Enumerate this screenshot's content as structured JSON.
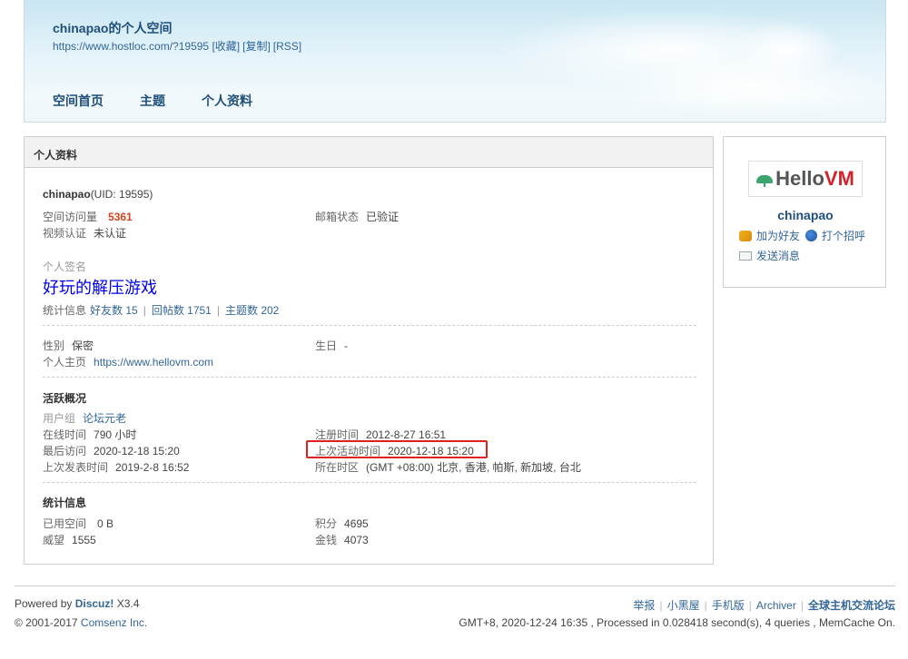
{
  "header": {
    "title": "chinapao的个人空间",
    "url": "https://www.hostloc.com/?19595",
    "link_collect": "[收藏]",
    "link_copy": "[复制]",
    "link_rss": "[RSS]",
    "nav": [
      "空间首页",
      "主题",
      "个人资料"
    ]
  },
  "profile": {
    "panel_title": "个人资料",
    "username": "chinapao",
    "uid": "(UID: 19595)",
    "visits_label": "空间访问量",
    "visits_value": "5361",
    "email_label": "邮箱状态",
    "email_value": "已验证",
    "video_label": "视频认证",
    "video_value": "未认证",
    "signature_label": "个人签名",
    "signature_value": "好玩的解压游戏",
    "stats_label": "统计信息",
    "stats_friends": "好友数 15",
    "stats_replies": "回帖数 1751",
    "stats_threads": "主题数 202",
    "stats_sep": "|",
    "gender_label": "性别",
    "gender_value": "保密",
    "birthday_label": "生日",
    "birthday_value": "-",
    "homepage_label": "个人主页",
    "homepage_value": "https://www.hellovm.com",
    "activity_title": "活跃概况",
    "group_label": "用户组",
    "group_value": "论坛元老",
    "online_label": "在线时间",
    "online_value": "790 小时",
    "register_label": "注册时间",
    "register_value": "2012-8-27 16:51",
    "lastvisit_label": "最后访问",
    "lastvisit_value": "2020-12-18 15:20",
    "lastactive_label": "上次活动时间",
    "lastactive_value": "2020-12-18 15:20",
    "lastpost_label": "上次发表时间",
    "lastpost_value": "2019-2-8 16:52",
    "timezone_label": "所在时区",
    "timezone_value": "(GMT +08:00) 北京, 香港, 帕斯, 新加坡, 台北",
    "stat_title": "统计信息",
    "space_label": "已用空间",
    "space_value": "0 B",
    "credits_label": "积分",
    "credits_value": "4695",
    "prestige_label": "威望",
    "prestige_value": "1555",
    "money_label": "金钱",
    "money_value": "4073"
  },
  "sidebar": {
    "logo_text_hello": "Hello",
    "logo_text_vm": "VM",
    "name": "chinapao",
    "add_friend": "加为好友",
    "poke": "打个招呼",
    "send_msg": "发送消息"
  },
  "footer": {
    "powered_prefix": "Powered by ",
    "powered_brand": "Discuz!",
    "powered_version": " X3.4",
    "copyright_prefix": "© 2001-2017 ",
    "copyright_company": "Comsenz Inc.",
    "links": [
      "举报",
      "小黑屋",
      "手机版",
      "Archiver",
      "全球主机交流论坛"
    ],
    "stats": "GMT+8, 2020-12-24 16:35 , Processed in 0.028418 second(s), 4 queries , MemCache On."
  },
  "colors": {
    "link": "#336699",
    "highlight": "#e02020",
    "visits": "#d5421d",
    "signature": "#0000ee"
  }
}
